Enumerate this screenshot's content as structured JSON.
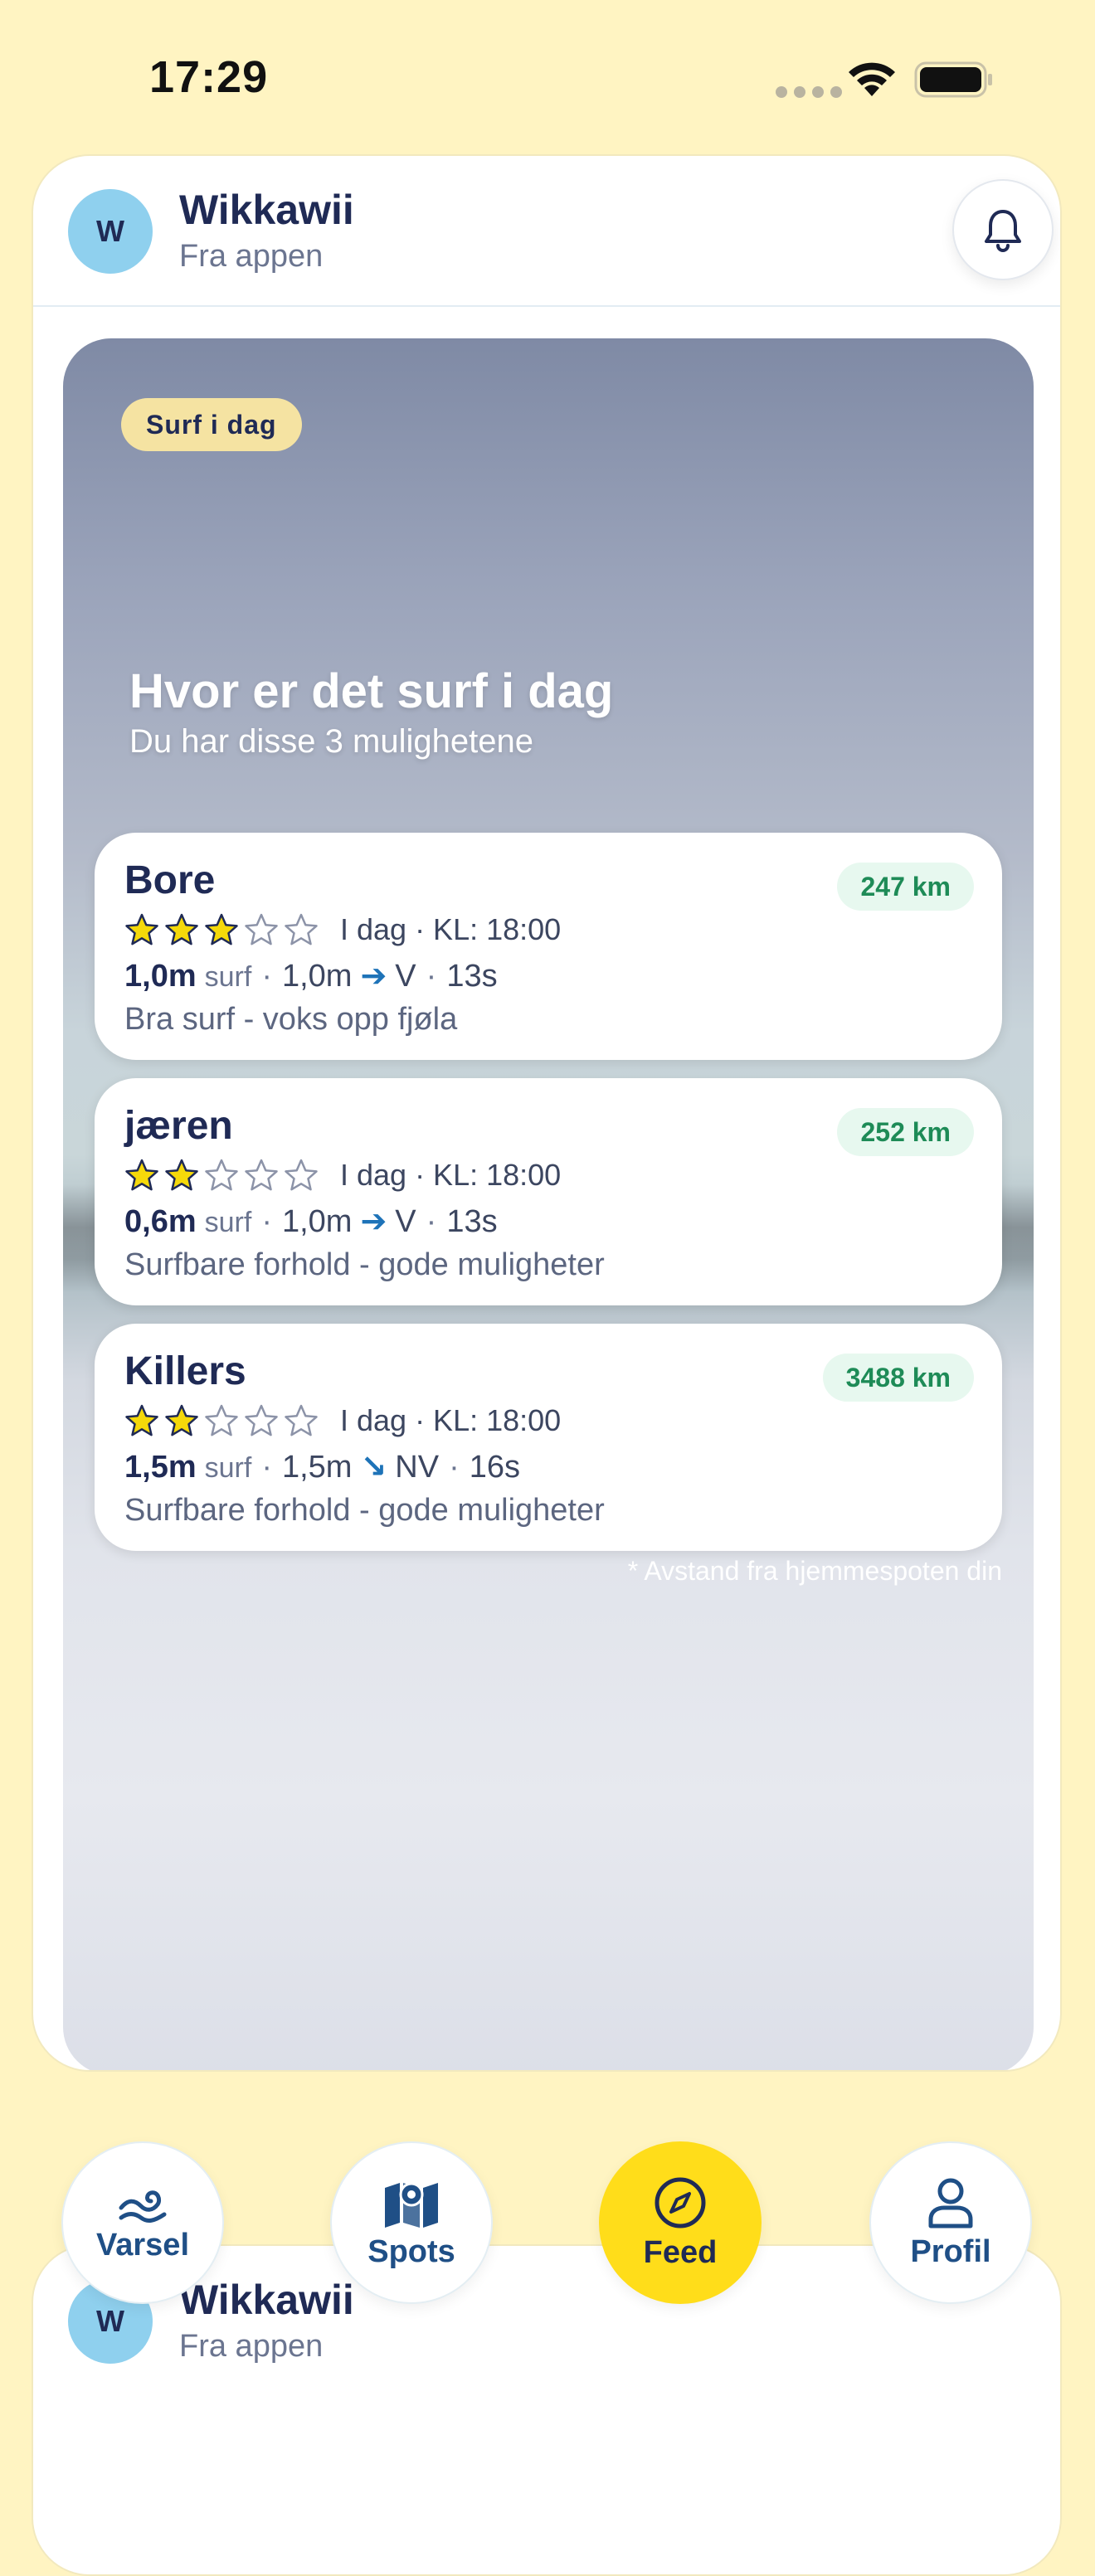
{
  "status_bar": {
    "time": "17:29"
  },
  "post": {
    "avatar_initial": "W",
    "author": "Wikkawii",
    "source": "Fra appen",
    "badge": "Surf i dag",
    "title": "Hvor er det surf i dag",
    "subtitle": "Du har disse 3 mulighetene",
    "footnote": "* Avstand fra hjemmespoten din",
    "spots": [
      {
        "name": "Bore",
        "distance": "247 km",
        "rating": 3,
        "max_rating": 5,
        "time": "I dag · KL: 18:00",
        "surf_height": "1,0m",
        "surf_word": "surf",
        "swell_height": "1,0m",
        "direction": "V",
        "direction_icon": "arrow-right-icon",
        "period": "13s",
        "description": "Bra surf - voks opp fjøla"
      },
      {
        "name": "jæren",
        "distance": "252 km",
        "rating": 2,
        "max_rating": 5,
        "time": "I dag · KL: 18:00",
        "surf_height": "0,6m",
        "surf_word": "surf",
        "swell_height": "1,0m",
        "direction": "V",
        "direction_icon": "arrow-right-icon",
        "period": "13s",
        "description": "Surfbare forhold - gode muligheter"
      },
      {
        "name": "Killers",
        "distance": "3488 km",
        "rating": 2,
        "max_rating": 5,
        "time": "I dag · KL: 18:00",
        "surf_height": "1,5m",
        "surf_word": "surf",
        "swell_height": "1,5m",
        "direction": "NV",
        "direction_icon": "arrow-down-right-icon",
        "period": "16s",
        "description": "Surfbare forhold - gode muligheter"
      }
    ]
  },
  "next_post": {
    "avatar_initial": "W",
    "author": "Wikkawii",
    "source": "Fra appen"
  },
  "tabs": [
    {
      "label": "Varsel",
      "icon": "wave-icon",
      "active": false
    },
    {
      "label": "Spots",
      "icon": "map-pin-icon",
      "active": false
    },
    {
      "label": "Feed",
      "icon": "compass-icon",
      "active": true
    },
    {
      "label": "Profil",
      "icon": "user-icon",
      "active": false
    }
  ],
  "colors": {
    "background": "#FFF4C2",
    "accent_yellow": "#FFDD1A",
    "navy": "#1F2A55",
    "distance_green": "#1E8B57",
    "star_yellow": "#F5D90A"
  }
}
